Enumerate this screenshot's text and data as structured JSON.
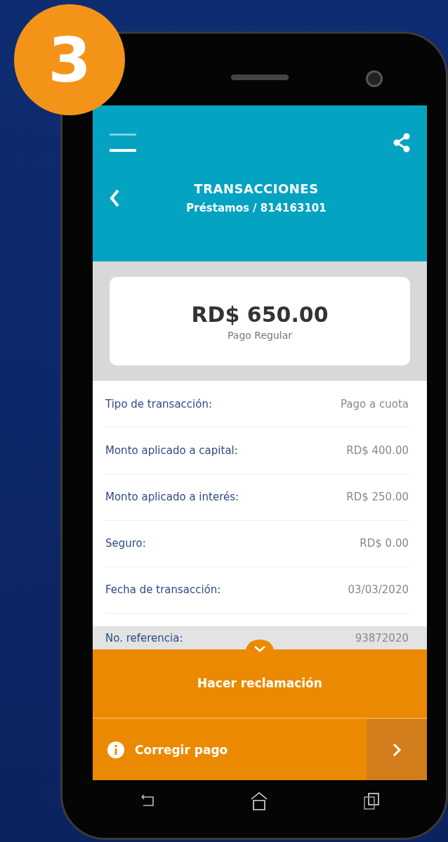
{
  "step_badge": "3",
  "header": {
    "title": "TRANSACCIONES",
    "subtitle": "Préstamos / 814163101"
  },
  "summary": {
    "amount": "RD$ 650.00",
    "label": "Pago Regular"
  },
  "details": [
    {
      "label": "Tipo de transacción:",
      "value": "Pago a cuota"
    },
    {
      "label": "Monto aplicado a capital:",
      "value": "RD$ 400.00"
    },
    {
      "label": "Monto aplicado a interés:",
      "value": "RD$ 250.00"
    },
    {
      "label": "Seguro:",
      "value": "RD$ 0.00"
    },
    {
      "label": "Fecha de transacción:",
      "value": "03/03/2020"
    }
  ],
  "reference": {
    "label": "No. referencia:",
    "value": "93872020"
  },
  "claim_button": "Hacer reclamación",
  "correct_payment": "Corregir pago"
}
